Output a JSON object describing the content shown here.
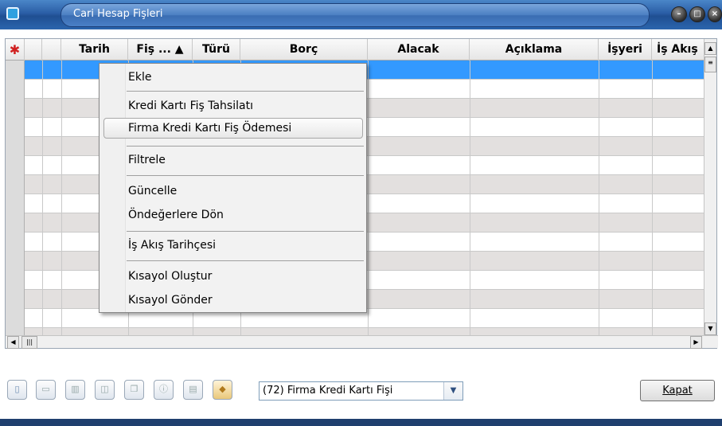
{
  "window": {
    "title": "Cari Hesap Fişleri"
  },
  "grid": {
    "columns": [
      "Tarih",
      "Fiş ... ▲",
      "Türü",
      "Borç",
      "Alacak",
      "Açıklama",
      "İşyeri",
      "İş Akış"
    ]
  },
  "context_menu": {
    "items": [
      "Ekle",
      "Kredi Kartı Fiş Tahsilatı",
      "Firma Kredi Kartı Fiş Ödemesi",
      "Filtrele",
      "Güncelle",
      "Öndeğerlere Dön",
      "İş Akış Tarihçesi",
      "Kısayol Oluştur",
      "Kısayol Gönder"
    ],
    "highlighted": "Firma Kredi Kartı Fiş Ödemesi"
  },
  "toolbar": {
    "combo_value": "(72) Firma Kredi Kartı Fişi",
    "close_label": "Kapat"
  }
}
